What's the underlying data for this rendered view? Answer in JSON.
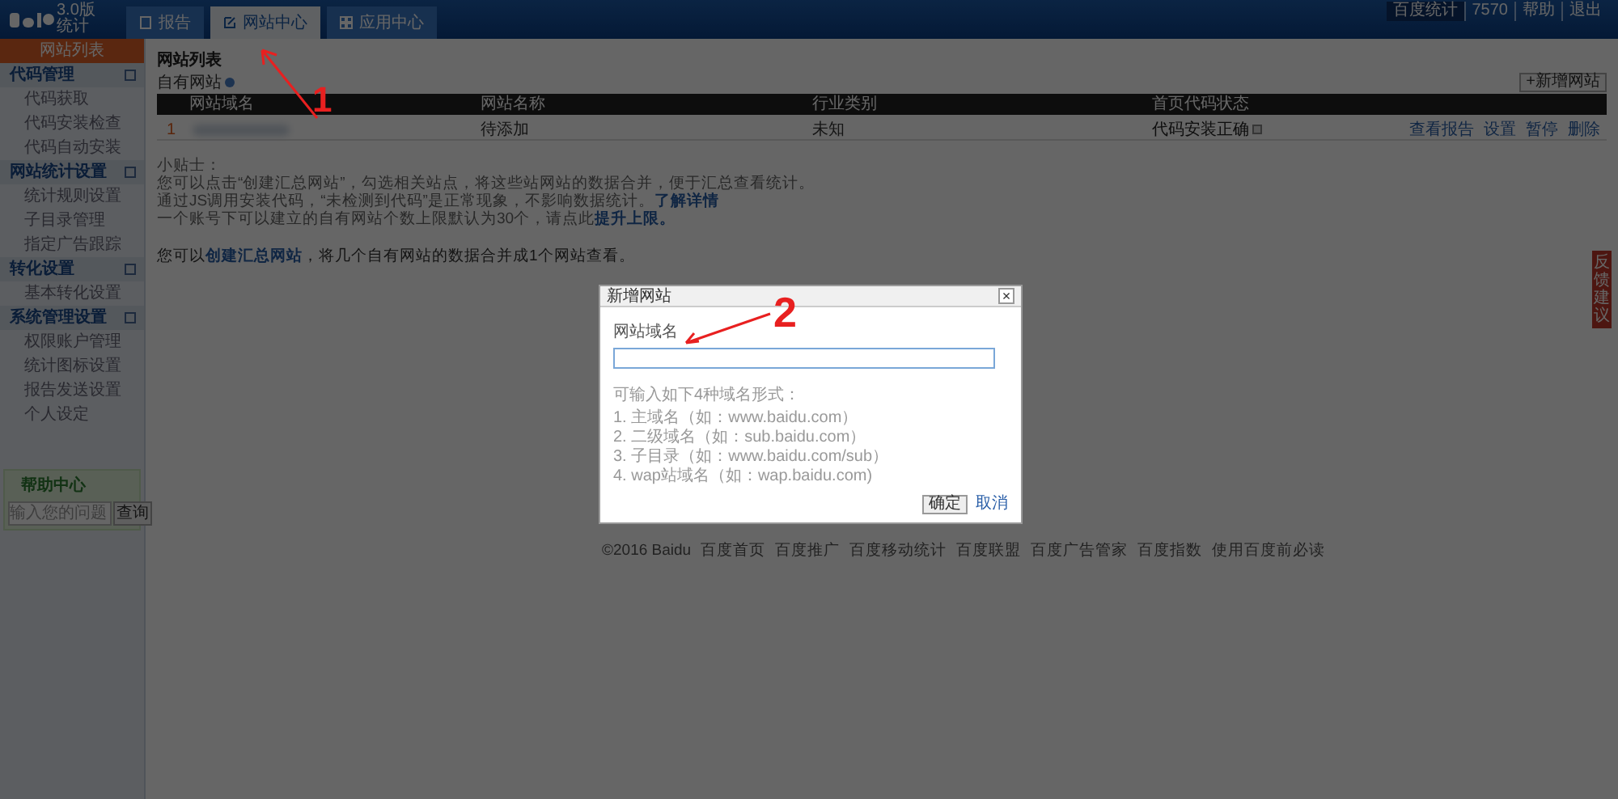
{
  "logo": {
    "version": "3.0版",
    "product": "统计"
  },
  "tabs": [
    {
      "label": "报告",
      "selected": false
    },
    {
      "label": "网站中心",
      "selected": true
    },
    {
      "label": "应用中心",
      "selected": false
    }
  ],
  "top_links": [
    {
      "label": "百度统计",
      "highlight": true
    },
    {
      "label": "7570",
      "highlight": false
    },
    {
      "label": "帮助",
      "highlight": false
    },
    {
      "label": "退出",
      "highlight": false
    }
  ],
  "sidebar": {
    "items": [
      {
        "kind": "item",
        "label": "网站列表",
        "selected": true
      },
      {
        "kind": "section",
        "label": "代码管理",
        "children": [
          {
            "label": "代码获取"
          },
          {
            "label": "代码安装检查"
          },
          {
            "label": "代码自动安装"
          }
        ]
      },
      {
        "kind": "section",
        "label": "网站统计设置",
        "children": [
          {
            "label": "统计规则设置"
          },
          {
            "label": "子目录管理"
          },
          {
            "label": "指定广告跟踪"
          }
        ]
      },
      {
        "kind": "section",
        "label": "转化设置",
        "children": [
          {
            "label": "基本转化设置"
          }
        ]
      },
      {
        "kind": "section",
        "label": "系统管理设置",
        "children": [
          {
            "label": "权限账户管理"
          },
          {
            "label": "统计图标设置"
          },
          {
            "label": "报告发送设置"
          },
          {
            "label": "个人设定"
          }
        ]
      }
    ],
    "help": {
      "title": "帮助中心",
      "placeholder": "输入您的问题",
      "button": "查询"
    }
  },
  "page": {
    "title": "网站列表",
    "subtitle": "自有网站",
    "add_button": "+新增网站"
  },
  "table": {
    "columns": [
      "网站域名",
      "网站名称",
      "行业类别",
      "首页代码状态"
    ],
    "rows": [
      {
        "index": "1",
        "name": "待添加",
        "industry": "未知",
        "status": "代码安装正确",
        "actions": [
          "查看报告",
          "设置",
          "暂停",
          "删除"
        ]
      }
    ]
  },
  "tips": {
    "title": "小贴士：",
    "lines": [
      "您可以点击“创建汇总网站”，勾选相关站点，将这些站网站的数据合并，便于汇总查看统计。",
      "通过JS调用安装代码，“未检测到代码”是正常现象，不影响数据统计。",
      "一个账号下可以建立的自有网站个数上限默认为30个，请点此"
    ],
    "links": [
      "了解详情",
      "提升上限。"
    ],
    "summary": [
      "您可以",
      "创建汇总网站",
      "，将几个自有网站的数据合并成1个网站查看。"
    ]
  },
  "footer": [
    "©2016 Baidu",
    "百度首页",
    "百度推广",
    "百度移动统计",
    "百度联盟",
    "百度广告管家",
    "百度指数",
    "使用百度前必读"
  ],
  "feedback": "反馈建议",
  "dialog": {
    "title": "新增网站",
    "close": "×",
    "field_label": "网站域名",
    "hint_title": "可输入如下4种域名形式：",
    "hints": [
      "1. 主域名（如：www.baidu.com）",
      "2. 二级域名（如：sub.baidu.com）",
      "3. 子目录（如：www.baidu.com/sub）",
      "4. wap站域名（如：wap.baidu.com)"
    ],
    "ok": "确定",
    "cancel": "取消"
  },
  "annotations": [
    "1",
    "2"
  ]
}
